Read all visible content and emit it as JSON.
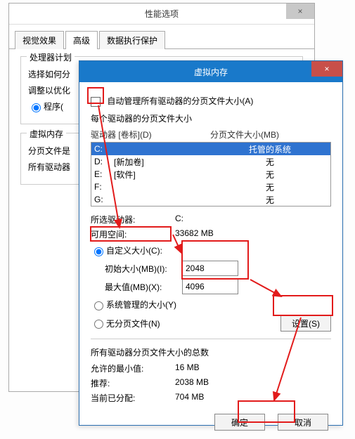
{
  "perf": {
    "title": "性能选项",
    "close": "×",
    "tabs": [
      "视觉效果",
      "高级",
      "数据执行保护"
    ],
    "active_tab_index": 1,
    "sched_legend": "处理器计划",
    "sched_text": "选择如何分",
    "adjust_label": "调整以优化",
    "programs_label": "程序(",
    "vm_legend": "虚拟内存",
    "vm_text": "分页文件是",
    "all_drives_text": "所有驱动器"
  },
  "vm": {
    "title": "虚拟内存",
    "close": "×",
    "auto_label": "自动管理所有驱动器的分页文件大小(A)",
    "each_label": "每个驱动器的分页文件大小",
    "col_drive": "驱动器 [卷标](D)",
    "col_size": "分页文件大小(MB)",
    "drives": [
      {
        "letter": "C:",
        "label": "",
        "size": "托管的系统",
        "selected": true
      },
      {
        "letter": "D:",
        "label": "[新加卷]",
        "size": "无",
        "selected": false
      },
      {
        "letter": "E:",
        "label": "[软件]",
        "size": "无",
        "selected": false
      },
      {
        "letter": "F:",
        "label": "",
        "size": "无",
        "selected": false
      },
      {
        "letter": "G:",
        "label": "",
        "size": "无",
        "selected": false
      }
    ],
    "selected_drive_label": "所选驱动器:",
    "selected_drive_value": "C:",
    "free_label": "可用空间:",
    "free_value": "33682 MB",
    "custom_label": "自定义大小(C):",
    "initial_label": "初始大小(MB)(I):",
    "initial_value": "2048",
    "max_label": "最大值(MB)(X):",
    "max_value": "4096",
    "system_label": "系统管理的大小(Y)",
    "none_label": "无分页文件(N)",
    "set_btn": "设置(S)",
    "totals_legend": "所有驱动器分页文件大小的总数",
    "min_label": "允许的最小值:",
    "min_value": "16 MB",
    "rec_label": "推荐:",
    "rec_value": "2038 MB",
    "cur_label": "当前已分配:",
    "cur_value": "704 MB",
    "ok_btn": "确定",
    "cancel_btn": "取消"
  }
}
